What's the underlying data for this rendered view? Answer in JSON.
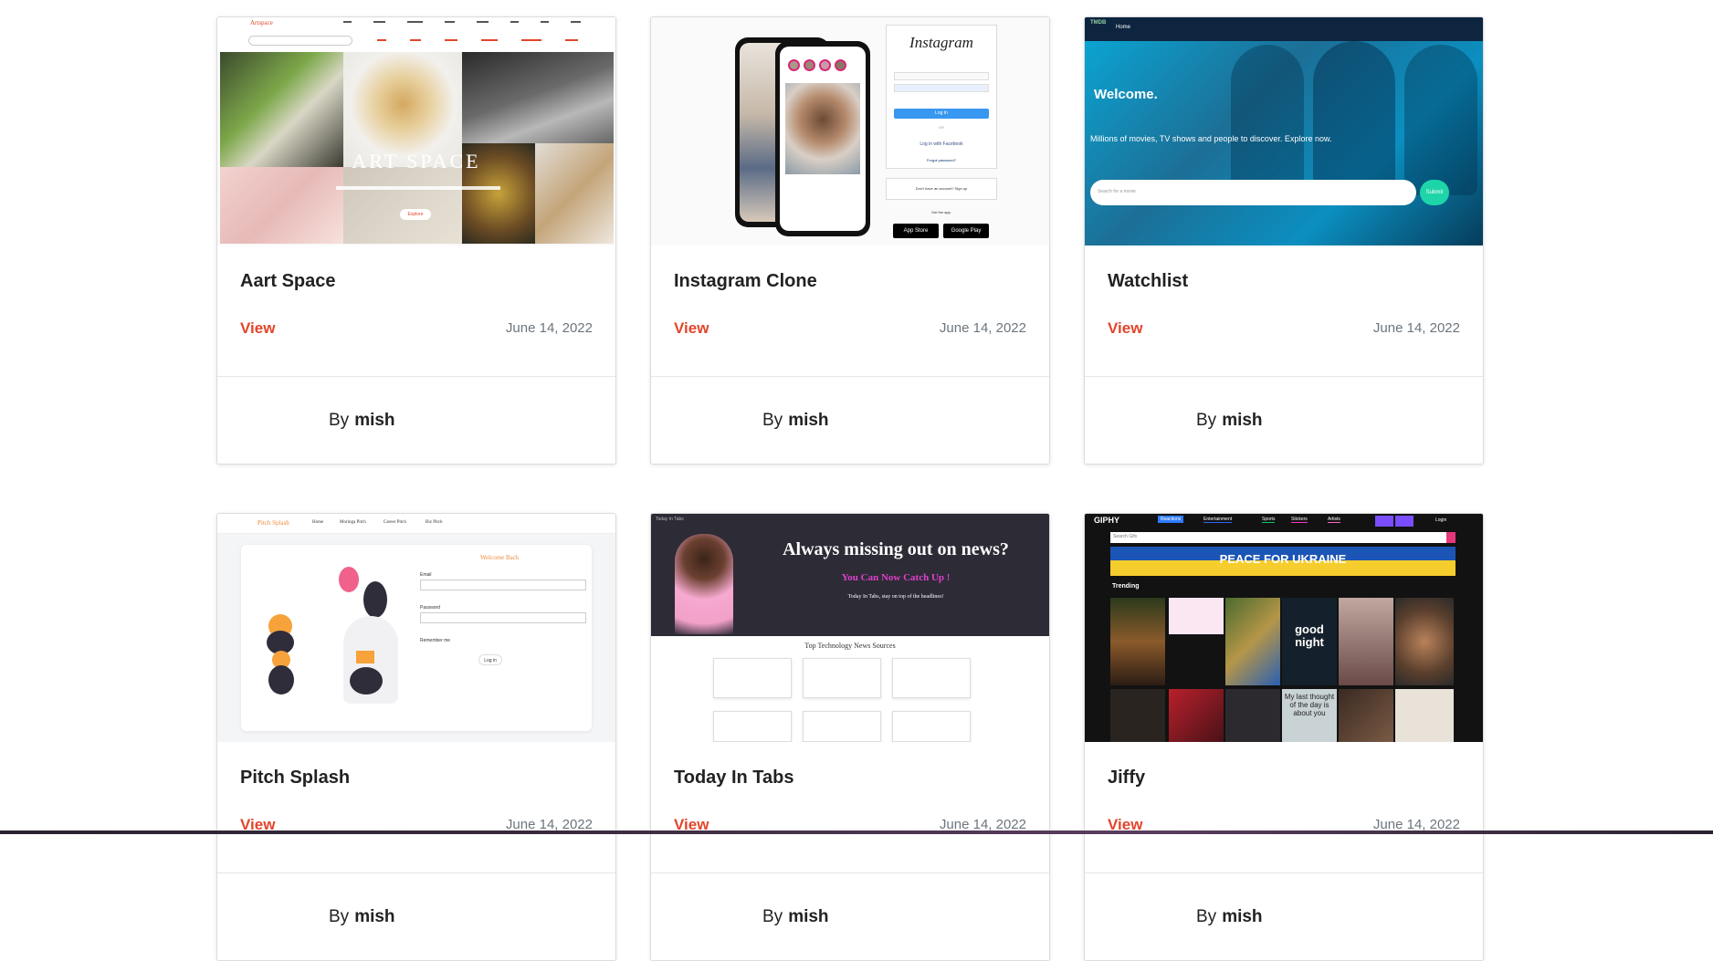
{
  "cards": [
    {
      "title": "Aart Space",
      "view_label": "View",
      "date": "June 14, 2022",
      "author_prefix": "By",
      "author": "mish",
      "thumb": {
        "brand": "Artspace",
        "heading": "ART SPACE",
        "button": "Explore"
      }
    },
    {
      "title": "Instagram Clone",
      "view_label": "View",
      "date": "June 14, 2022",
      "author_prefix": "By",
      "author": "mish",
      "thumb": {
        "logo": "Instagram",
        "login_button": "Log In",
        "or": "OR",
        "facebook": "Log in with Facebook",
        "forgot": "Forgot password?",
        "signup": "Don't have an account? Sign up",
        "get_app": "Get the app.",
        "app_store": "App Store",
        "google_play": "Google Play"
      }
    },
    {
      "title": "Watchlist",
      "view_label": "View",
      "date": "June 14, 2022",
      "author_prefix": "By",
      "author": "mish",
      "thumb": {
        "brand": "TMDB",
        "nav": "Home",
        "welcome": "Welcome.",
        "subtitle": "Millions of movies, TV shows and people to discover. Explore now.",
        "search_placeholder": "Search for a movie",
        "search_button": "Submit"
      }
    },
    {
      "title": "Pitch Splash",
      "view_label": "View",
      "date": "June 14, 2022",
      "author_prefix": "By",
      "author": "mish",
      "thumb": {
        "brand": "Pitch Splash",
        "nav": [
          "Home",
          "Moringa Pitch",
          "Career Pitch",
          "Biz Pitch"
        ],
        "welcome": "Welcome Back",
        "email_label": "Email",
        "password_label": "Password",
        "remember": "Remember me",
        "login": "Log in"
      }
    },
    {
      "title": "Today In Tabs",
      "view_label": "View",
      "date": "June 14, 2022",
      "author_prefix": "By",
      "author": "mish",
      "thumb": {
        "brand": "Today In Tabs",
        "headline": "Always missing out on news?",
        "subheadline": "You Can Now Catch Up !",
        "tagline": "Today In Tabs, stay on top of the headlines!",
        "section": "Top Technology News Sources"
      }
    },
    {
      "title": "Jiffy",
      "view_label": "View",
      "date": "June 14, 2022",
      "author_prefix": "By",
      "author": "mish",
      "thumb": {
        "brand": "GIPHY",
        "nav": [
          "Reactions",
          "Entertainment",
          "Sports",
          "Stickers",
          "Artists"
        ],
        "login": "Login",
        "search_placeholder": "Search Gifs",
        "banner": "PEACE FOR UKRAINE",
        "trending": "Trending",
        "gif_text_1": "good night",
        "gif_text_2": "My last thought of the day is about you"
      }
    }
  ]
}
